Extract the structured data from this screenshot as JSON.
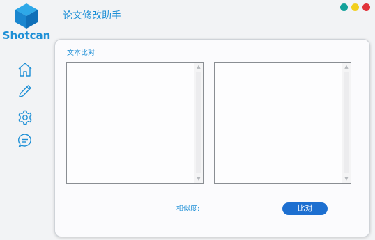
{
  "app": {
    "brand": "Shotcan",
    "title": "论文修改助手"
  },
  "colors": {
    "accent": "#1d8fd6",
    "button": "#1d6fd0",
    "dot_teal": "#12a19a",
    "dot_yellow": "#f2cf1c",
    "dot_red": "#e1333a"
  },
  "sidebar": {
    "icons": [
      "home-icon",
      "pencil-icon",
      "gear-icon",
      "chat-icon"
    ]
  },
  "panel": {
    "title": "文本比对",
    "left_text": "",
    "right_text": "",
    "similarity_label": "相似度:",
    "similarity_value": "",
    "compare_button": "比对"
  }
}
